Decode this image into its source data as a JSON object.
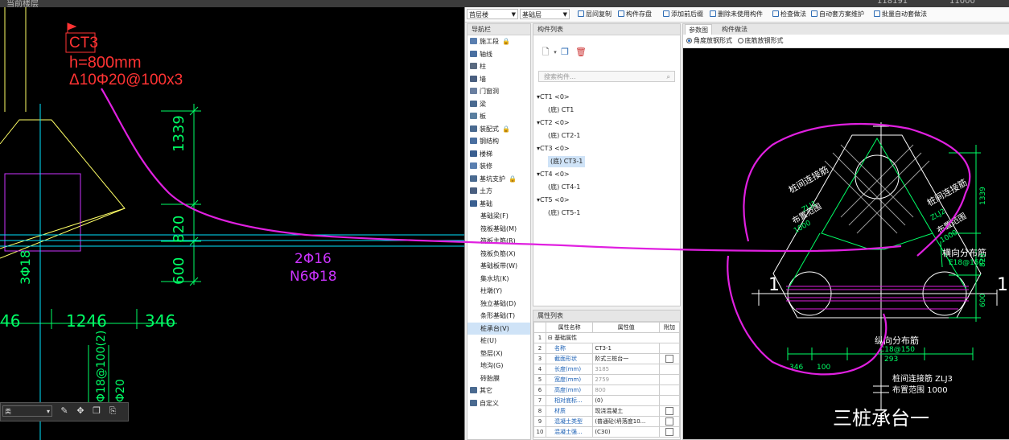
{
  "window": {
    "title": "当前楼层",
    "readout_1": "118191",
    "readout_2": "11000"
  },
  "cad": {
    "label_id": "CT3",
    "label_h": "h=800mm",
    "label_rebar": "Δ10Φ20@100x3",
    "dim_1339": "1339",
    "dim_820": "820",
    "dim_600": "600",
    "dim_346_left": "46",
    "dim_1246": "1246",
    "dim_346_right": "346",
    "rebar_2phi16": "2Φ16",
    "rebar_n6": "N6Φ18",
    "rebar_3phi18": "3Φ18",
    "rebar_bottom": "2Φ18@100(2)",
    "rebar_col": "2Φ20",
    "combo_value": "类"
  },
  "toolbar": {
    "floor": "首层楼",
    "layer": "基础层",
    "btn_copy_floor": "层间复制",
    "btn_save_comp": "构件存盘",
    "btn_add_prefix": "添加前后缀",
    "btn_delete_unused": "删除未使用构件",
    "btn_check": "检查做法",
    "btn_auto_plan": "自动套方案维护",
    "btn_batch_auto": "批量自动套做法"
  },
  "nav": {
    "title": "导航栏",
    "items": [
      {
        "label": "施工段",
        "icon": "construction-section-icon",
        "color": "#5a7fb0",
        "locked": true
      },
      {
        "label": "轴线",
        "icon": "axis-grid-icon",
        "color": "#4a6fa0",
        "locked": false
      },
      {
        "label": "柱",
        "icon": "column-icon",
        "color": "#5a6a80",
        "locked": false
      },
      {
        "label": "墙",
        "icon": "wall-icon",
        "color": "#4a5f80",
        "locked": false
      },
      {
        "label": "门窗洞",
        "icon": "door-window-icon",
        "color": "#6a7fa0",
        "locked": false
      },
      {
        "label": "梁",
        "icon": "beam-icon",
        "color": "#4a6a90",
        "locked": false
      },
      {
        "label": "板",
        "icon": "slab-icon",
        "color": "#5a7fa0",
        "locked": false
      },
      {
        "label": "装配式",
        "icon": "prefab-icon",
        "color": "#4a6a90",
        "locked": true
      },
      {
        "label": "钢结构",
        "icon": "steel-structure-icon",
        "color": "#4a6fa0",
        "locked": false
      },
      {
        "label": "楼梯",
        "icon": "stair-icon",
        "color": "#3a5f90",
        "locked": false
      },
      {
        "label": "装修",
        "icon": "decoration-icon",
        "color": "#5a7fb0",
        "locked": false
      },
      {
        "label": "基坑支护",
        "icon": "pit-support-icon",
        "color": "#4a6a90",
        "locked": true
      },
      {
        "label": "土方",
        "icon": "earthwork-icon",
        "color": "#4a5f80",
        "locked": false
      },
      {
        "label": "基础",
        "icon": "foundation-icon",
        "color": "#3a5f90",
        "locked": false
      }
    ],
    "sub_items": [
      "基础梁(F)",
      "筏板基础(M)",
      "筏板主筋(R)",
      "筏板负筋(X)",
      "基础板带(W)",
      "集水坑(K)",
      "柱墩(Y)",
      "独立基础(D)",
      "条形基础(T)",
      "桩承台(V)",
      "桩(U)",
      "垫层(X)",
      "地沟(G)",
      "砖胎膜"
    ],
    "selected_sub": "桩承台(V)",
    "bottom_items": [
      {
        "label": "其它",
        "icon": "other-icon"
      },
      {
        "label": "自定义",
        "icon": "custom-icon"
      }
    ]
  },
  "component_list": {
    "title": "构件列表",
    "search_placeholder": "搜索构件...",
    "groups": [
      {
        "name": "CT1 <0>",
        "child": "(底) CT1"
      },
      {
        "name": "CT2 <0>",
        "child": "(底) CT2-1"
      },
      {
        "name": "CT3 <0>",
        "child": "(底) CT3-1"
      },
      {
        "name": "CT4 <0>",
        "child": "(底) CT4-1"
      },
      {
        "name": "CT5 <0>",
        "child": "(底) CT5-1"
      }
    ],
    "selected_child": "(底) CT3-1"
  },
  "properties": {
    "title": "属性列表",
    "col_name": "属性名称",
    "col_value": "属性值",
    "col_attach": "附加",
    "group_label": "基础属性",
    "rows": [
      {
        "n": "2",
        "name": "名称",
        "value": "CT3-1",
        "dim": false,
        "cb": false
      },
      {
        "n": "3",
        "name": "截面形状",
        "value": "阶式三桩台一",
        "dim": false,
        "cb": true
      },
      {
        "n": "4",
        "name": "长度(mm)",
        "value": "3185",
        "dim": true,
        "cb": false
      },
      {
        "n": "5",
        "name": "宽度(mm)",
        "value": "2759",
        "dim": true,
        "cb": false
      },
      {
        "n": "6",
        "name": "高度(mm)",
        "value": "800",
        "dim": true,
        "cb": false
      },
      {
        "n": "7",
        "name": "相对底标...",
        "value": "(0)",
        "dim": false,
        "cb": false
      },
      {
        "n": "8",
        "name": "材质",
        "value": "现浇混凝土",
        "dim": false,
        "cb": true
      },
      {
        "n": "9",
        "name": "混凝土类型",
        "value": "(普通砼(坍落度10...",
        "dim": false,
        "cb": true
      },
      {
        "n": "10",
        "name": "混凝土强...",
        "value": "(C30)",
        "dim": false,
        "cb": true
      }
    ]
  },
  "diagram": {
    "tab_active": "参数图",
    "tab_other": "构件做法",
    "radio_1": "角度放钢形式",
    "radio_2": "底筋放钢形式",
    "title": "三桩承台一",
    "lbl_pile_link_left": "桩间连接筋",
    "lbl_zlj1": "ZLJ1",
    "lbl_range_left": "布置范围",
    "lbl_1000_left": "1000",
    "lbl_pile_link_right": "桩间连接筋",
    "lbl_zlj2": "ZLJ2",
    "lbl_range_right": "布置范围",
    "lbl_1000_right": "1000",
    "lbl_transverse": "横向分布筋",
    "lbl_e18": "E18@150",
    "lbl_longitudinal": "纵向分布筋",
    "lbl_c18": "C18@150",
    "lbl_pile_link_bottom": "桩间连接筋 ZLJ3",
    "lbl_range_bottom": "布置范围 1000",
    "dim_346": "346",
    "dim_100": "100",
    "dim_293": "293",
    "dim_1339": "1339",
    "dim_820": "820",
    "dim_600": "600",
    "section_mark": "1"
  },
  "colors": {
    "cad_line": "#ffff66",
    "cad_dim": "#00ff66",
    "cad_label": "#ff3333",
    "annotation": "#e020e0",
    "cyan": "#00e5ff"
  }
}
